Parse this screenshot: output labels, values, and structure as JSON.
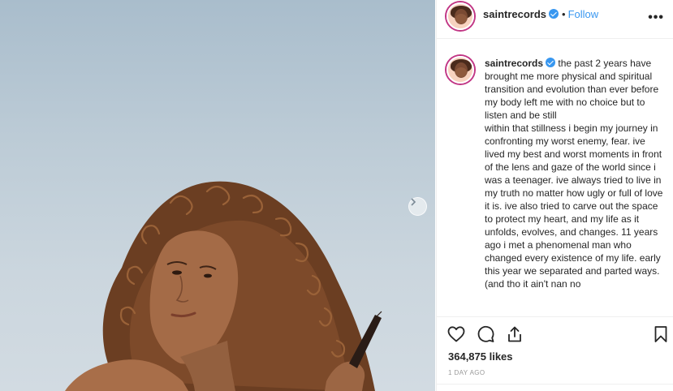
{
  "header": {
    "username": "saintrecords",
    "separator": "•",
    "follow_label": "Follow",
    "more_label": "•••"
  },
  "caption": {
    "username": "saintrecords",
    "lines": [
      "the past 2 years have brought me more physical and spiritual transition and evolution than ever before",
      "my body left me with no choice but to listen and be still",
      "within that stillness i begin my journey in confronting my worst enemy, fear. ive lived my best and worst moments in front of the lens and gaze of the world since i was a teenager. ive always tried to live in my truth no matter how ugly or full of love it is. ive also tried to carve out the space to protect my heart, and my life as it unfolds, evolves, and changes. 11 years ago i met a phenomenal man who changed every existence of my life. early this year we separated and parted ways. (and tho it ain't nan no"
    ]
  },
  "post": {
    "likes": "364,875 likes",
    "time": "1 DAY AGO"
  },
  "icons": {
    "like": "heart-icon",
    "comment": "comment-icon",
    "share": "share-icon",
    "save": "bookmark-icon",
    "next": "chevron-right-icon",
    "verified": "verified-badge-icon"
  },
  "colors": {
    "accent": "#3897f0",
    "text": "#262626",
    "muted": "#999999",
    "border": "#efefef",
    "story_ring": "#c13584"
  }
}
